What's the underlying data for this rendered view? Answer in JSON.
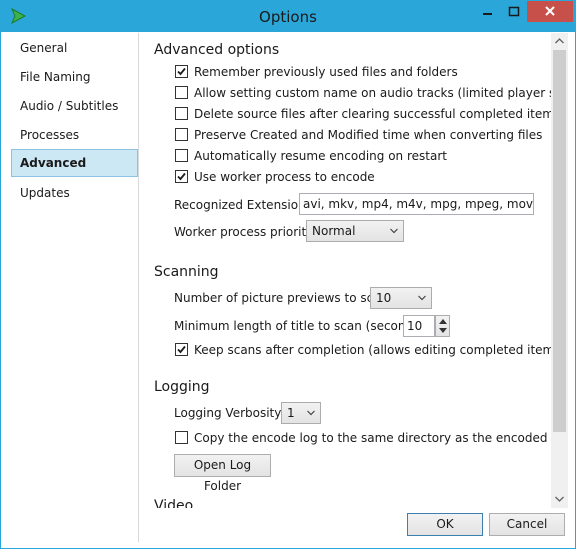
{
  "window": {
    "title": "Options",
    "app_icon": "handbrake-play-icon",
    "accent_color": "#2ba6d8",
    "close_color": "#c7504a"
  },
  "sidebar": {
    "items": [
      {
        "label": "General",
        "selected": false
      },
      {
        "label": "File Naming",
        "selected": false
      },
      {
        "label": "Audio / Subtitles",
        "selected": false
      },
      {
        "label": "Processes",
        "selected": false
      },
      {
        "label": "Advanced",
        "selected": true
      },
      {
        "label": "Updates",
        "selected": false
      }
    ]
  },
  "advanced": {
    "title": "Advanced options",
    "checkboxes": [
      {
        "label": "Remember previously used files and folders",
        "checked": true
      },
      {
        "label": "Allow setting custom name on audio tracks (limited player suppor",
        "checked": false
      },
      {
        "label": "Delete source files after clearing successful completed items (with",
        "checked": false
      },
      {
        "label": "Preserve Created and Modified time when converting files",
        "checked": false
      },
      {
        "label": "Automatically resume encoding on restart",
        "checked": false
      },
      {
        "label": "Use worker process to encode",
        "checked": true
      }
    ],
    "extensions_label": "Recognized Extensions:",
    "extensions_value": "avi, mkv, mp4, m4v, mpg, mpeg, mov, wm",
    "priority_label": "Worker process priority:",
    "priority_value": "Normal"
  },
  "scanning": {
    "title": "Scanning",
    "previews_label": "Number of picture previews to scan:",
    "previews_value": "10",
    "min_length_label": "Minimum length of title to scan (seconds):",
    "min_length_value": "10",
    "keep_scans_label": "Keep scans after completion (allows editing completed items)",
    "keep_scans_checked": true
  },
  "logging": {
    "title": "Logging",
    "verbosity_label": "Logging Verbosity:",
    "verbosity_value": "1",
    "copy_log_label": "Copy the encode log to the same directory as the encoded video",
    "copy_log_checked": false,
    "open_folder_button": "Open Log Folder"
  },
  "video": {
    "title": "Video"
  },
  "footer": {
    "ok_label": "OK",
    "cancel_label": "Cancel"
  }
}
